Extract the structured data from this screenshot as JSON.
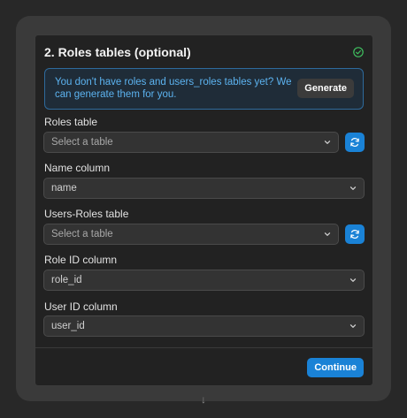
{
  "connector": {
    "top_arrow": "↓",
    "bottom_arrow": "↓"
  },
  "card": {
    "title": "2. Roles tables (optional)",
    "status_icon": "check-circle-icon",
    "status_color": "#3fbf5f"
  },
  "notice": {
    "text": "You don't have roles and users_roles tables yet? We can generate them for you.",
    "generate_label": "Generate"
  },
  "fields": {
    "roles_table": {
      "label": "Roles table",
      "value": "Select a table",
      "refresh_icon": "refresh-icon"
    },
    "name_column": {
      "label": "Name column",
      "value": "name"
    },
    "users_roles_table": {
      "label": "Users-Roles table",
      "value": "Select a table",
      "refresh_icon": "refresh-icon"
    },
    "role_id_column": {
      "label": "Role ID column",
      "value": "role_id"
    },
    "user_id_column": {
      "label": "User ID column",
      "value": "user_id"
    }
  },
  "footer": {
    "continue_label": "Continue"
  },
  "colors": {
    "accent": "#1a82d6",
    "notice_text": "#5cb3f0",
    "notice_border": "#2e6a9c"
  }
}
